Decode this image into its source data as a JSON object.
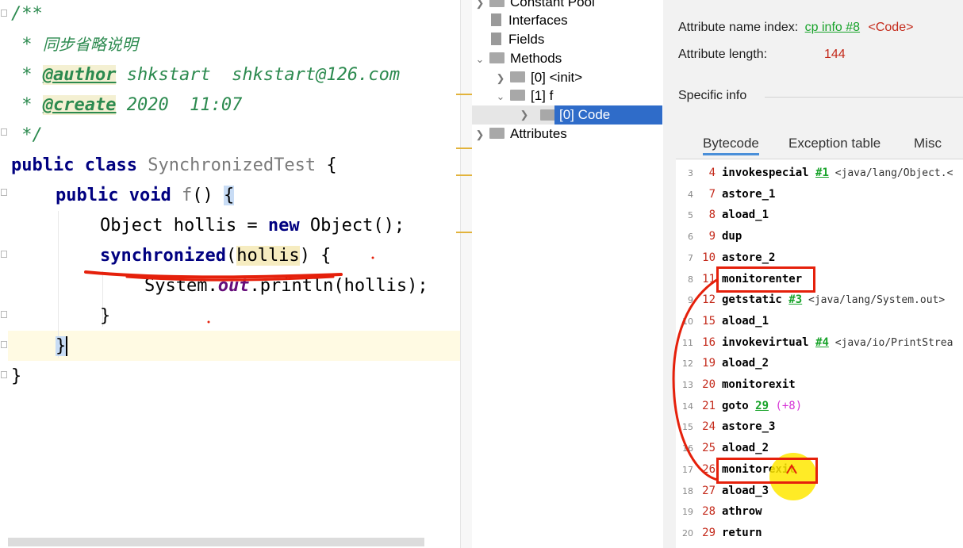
{
  "editor": {
    "lines": {
      "l1": "/**",
      "l2_star": " * ",
      "l2_text": "同步省略说明",
      "l3_star": " * ",
      "l3_tag": "@author",
      "l3_text": " shkstart  shkstart@126.com",
      "l4_star": " * ",
      "l4_tag": "@create",
      "l4_text": " 2020  11:07",
      "l5": " */",
      "l6_kw": "public class",
      "l6_name": " SynchronizedTest",
      "l6_rest": " {",
      "l7_kw": "public void",
      "l7_name": " f",
      "l7_paren": "() ",
      "l7_brace": "{",
      "l8_a": "Object hollis = ",
      "l8_kw": "new",
      "l8_b": " Object();",
      "l9_kw": "synchronized",
      "l9_p1": "(",
      "l9_var": "hollis",
      "l9_p2": ") {",
      "l10_a": "System.",
      "l10_fld": "out",
      "l10_b": ".println(hollis);",
      "l11": "}",
      "l12": "}",
      "l13": "}"
    }
  },
  "tree": {
    "constant_pool": "Constant Pool",
    "interfaces": "Interfaces",
    "fields": "Fields",
    "methods": "Methods",
    "init": "[0] <init>",
    "f": "[1] f",
    "code": "[0] Code",
    "attributes": "Attributes"
  },
  "info": {
    "name_index_label": "Attribute name index:",
    "name_index_link": "cp info #8",
    "name_index_value": "<Code>",
    "length_label": "Attribute length:",
    "length_value": "144",
    "specific_info": "Specific info",
    "tabs": {
      "bytecode": "Bytecode",
      "exception_table": "Exception table",
      "misc": "Misc"
    }
  },
  "bytecode": [
    {
      "ln": "3",
      "off": "4",
      "op": "invokespecial",
      "ref": "#1",
      "cm": " <java/lang/Object.<"
    },
    {
      "ln": "4",
      "off": "7",
      "op": "astore_1"
    },
    {
      "ln": "5",
      "off": "8",
      "op": "aload_1"
    },
    {
      "ln": "6",
      "off": "9",
      "op": "dup"
    },
    {
      "ln": "7",
      "off": "10",
      "op": "astore_2"
    },
    {
      "ln": "8",
      "off": "11",
      "op": "monitorenter"
    },
    {
      "ln": "9",
      "off": "12",
      "op": "getstatic",
      "ref": "#3",
      "cm": " <java/lang/System.out>"
    },
    {
      "ln": "10",
      "off": "15",
      "op": "aload_1"
    },
    {
      "ln": "11",
      "off": "16",
      "op": "invokevirtual",
      "ref": "#4",
      "cm": " <java/io/PrintStrea"
    },
    {
      "ln": "12",
      "off": "19",
      "op": "aload_2"
    },
    {
      "ln": "13",
      "off": "20",
      "op": "monitorexit"
    },
    {
      "ln": "14",
      "off": "21",
      "op": "goto",
      "ref": "29",
      "delta": " (+8)"
    },
    {
      "ln": "15",
      "off": "24",
      "op": "astore_3"
    },
    {
      "ln": "16",
      "off": "25",
      "op": "aload_2"
    },
    {
      "ln": "17",
      "off": "26",
      "op": "monitorexit"
    },
    {
      "ln": "18",
      "off": "27",
      "op": "aload_3"
    },
    {
      "ln": "19",
      "off": "28",
      "op": "athrow"
    },
    {
      "ln": "20",
      "off": "29",
      "op": "return"
    }
  ],
  "colors": {
    "accent": "#2f6cc9",
    "annotation": "#e5200b",
    "link": "#18a32a",
    "offset": "#c42a1b"
  }
}
